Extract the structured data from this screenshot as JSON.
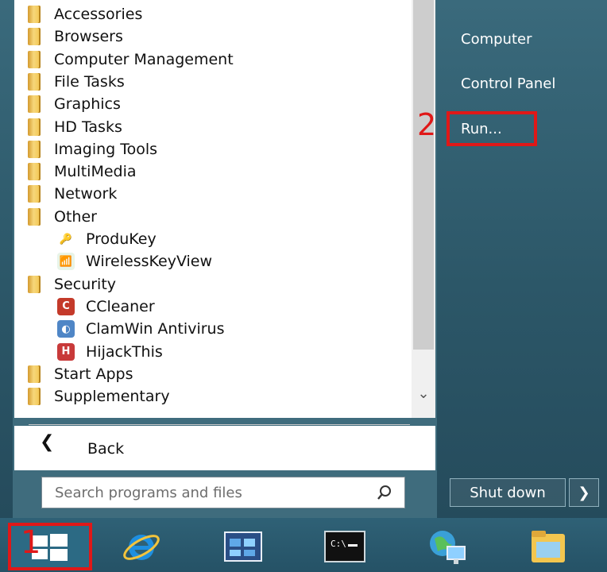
{
  "start_menu": {
    "programs": [
      {
        "label": "Accessories",
        "type": "folder"
      },
      {
        "label": "Browsers",
        "type": "folder"
      },
      {
        "label": "Computer Management",
        "type": "folder"
      },
      {
        "label": "File Tasks",
        "type": "folder"
      },
      {
        "label": "Graphics",
        "type": "folder"
      },
      {
        "label": "HD Tasks",
        "type": "folder"
      },
      {
        "label": "Imaging Tools",
        "type": "folder"
      },
      {
        "label": "MultiMedia",
        "type": "folder"
      },
      {
        "label": "Network",
        "type": "folder"
      },
      {
        "label": "Other",
        "type": "folder"
      },
      {
        "label": "ProduKey",
        "type": "app",
        "icon": "produkey-icon"
      },
      {
        "label": "WirelessKeyView",
        "type": "app",
        "icon": "wirelesskeyview-icon"
      },
      {
        "label": "Security",
        "type": "folder"
      },
      {
        "label": "CCleaner",
        "type": "app",
        "icon": "ccleaner-icon"
      },
      {
        "label": "ClamWin Antivirus",
        "type": "app",
        "icon": "clamwin-icon"
      },
      {
        "label": "HijackThis",
        "type": "app",
        "icon": "hijackthis-icon"
      },
      {
        "label": "Start Apps",
        "type": "folder"
      },
      {
        "label": "Supplementary",
        "type": "folder"
      }
    ],
    "back_label": "Back",
    "search_placeholder": "Search programs and files",
    "right_items": [
      "Computer",
      "Control Panel",
      "Run..."
    ],
    "shutdown_label": "Shut down",
    "step_markers": {
      "start": "1",
      "run": "2"
    }
  },
  "taskbar": {
    "icons": [
      "start-icon",
      "internet-explorer-icon",
      "control-panel-icon",
      "command-prompt-icon",
      "network-globe-icon",
      "file-explorer-icon"
    ]
  },
  "colors": {
    "highlight": "#e01818",
    "menu_accent": "#2c5768"
  }
}
